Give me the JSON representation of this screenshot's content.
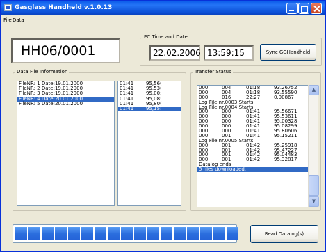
{
  "window": {
    "title": "Gasglass Handheld v.1.0.13"
  },
  "menu": {
    "items": [
      "File",
      "Data"
    ]
  },
  "station_id": "HH06/0001",
  "pc_time": {
    "legend": "PC Time and Date",
    "date": "22.02.2006",
    "time": "13:59:15",
    "sync_label": "Sync GGHandheld"
  },
  "data_file_info": {
    "legend": "Data File Information",
    "files": [
      {
        "text": "FileNR: 1 Date:19.01.2000",
        "selected": false
      },
      {
        "text": "FileNR: 2 Date:19.01.2000",
        "selected": false
      },
      {
        "text": "FileNR: 3 Date:19.01.2000",
        "selected": false
      },
      {
        "text": "FileNR: 4 Date:20.01.2000",
        "selected": true
      },
      {
        "text": "FileNR: 5 Date:20.01.2000",
        "selected": false
      }
    ],
    "times": [
      {
        "time": "01:41",
        "value": "95,56(",
        "selected": false
      },
      {
        "time": "01:41",
        "value": "95,53(",
        "selected": false
      },
      {
        "time": "01:41",
        "value": "95,00:",
        "selected": false
      },
      {
        "time": "01:41",
        "value": "95,08:",
        "selected": false
      },
      {
        "time": "01:41",
        "value": "95,80(",
        "selected": false
      },
      {
        "time": "01:41",
        "value": "95,15:",
        "selected": true
      }
    ]
  },
  "transfer_status": {
    "legend": "Transfer Status",
    "log": [
      {
        "c1": "000",
        "c2": "004",
        "c3": "01:18",
        "c4": "93.26752"
      },
      {
        "c1": "000",
        "c2": "004",
        "c3": "01:18",
        "c4": "93.55590"
      },
      {
        "c1": "000",
        "c2": "016",
        "c3": "22:27",
        "c4": "0.00867"
      },
      {
        "text": "Log File nr.0003 Starts"
      },
      {
        "text": "Log File nr.0004 Starts"
      },
      {
        "c1": "000",
        "c2": "000",
        "c3": "01:41",
        "c4": "95.56671"
      },
      {
        "c1": "000",
        "c2": "000",
        "c3": "01:41",
        "c4": "95.53611"
      },
      {
        "c1": "000",
        "c2": "000",
        "c3": "01:41",
        "c4": "95.00328"
      },
      {
        "c1": "000",
        "c2": "000",
        "c3": "01:41",
        "c4": "95.08299"
      },
      {
        "c1": "000",
        "c2": "000",
        "c3": "01:41",
        "c4": "95.80606"
      },
      {
        "c1": "000",
        "c2": "001",
        "c3": "01:41",
        "c4": "95.15211"
      },
      {
        "text": "Log File nr.0005 Starts"
      },
      {
        "c1": "000",
        "c2": "001",
        "c3": "01:42",
        "c4": "95.25918"
      },
      {
        "c1": "000",
        "c2": "001",
        "c3": "01:42",
        "c4": "95.47227"
      },
      {
        "c1": "000",
        "c2": "001",
        "c3": "01:42",
        "c4": "95.04483"
      },
      {
        "c1": "000",
        "c2": "001",
        "c3": "01:42",
        "c4": "95.32817"
      },
      {
        "text": "Datalog ends"
      },
      {
        "text": "5 files downloaded.",
        "selected": true
      }
    ]
  },
  "progress": {
    "fraction": 1.0
  },
  "read_label": "Read Datalog(s)",
  "colors": {
    "selection": "#316ac5",
    "titlebar": "#0a5ae8",
    "progress": "#2b6ede"
  }
}
